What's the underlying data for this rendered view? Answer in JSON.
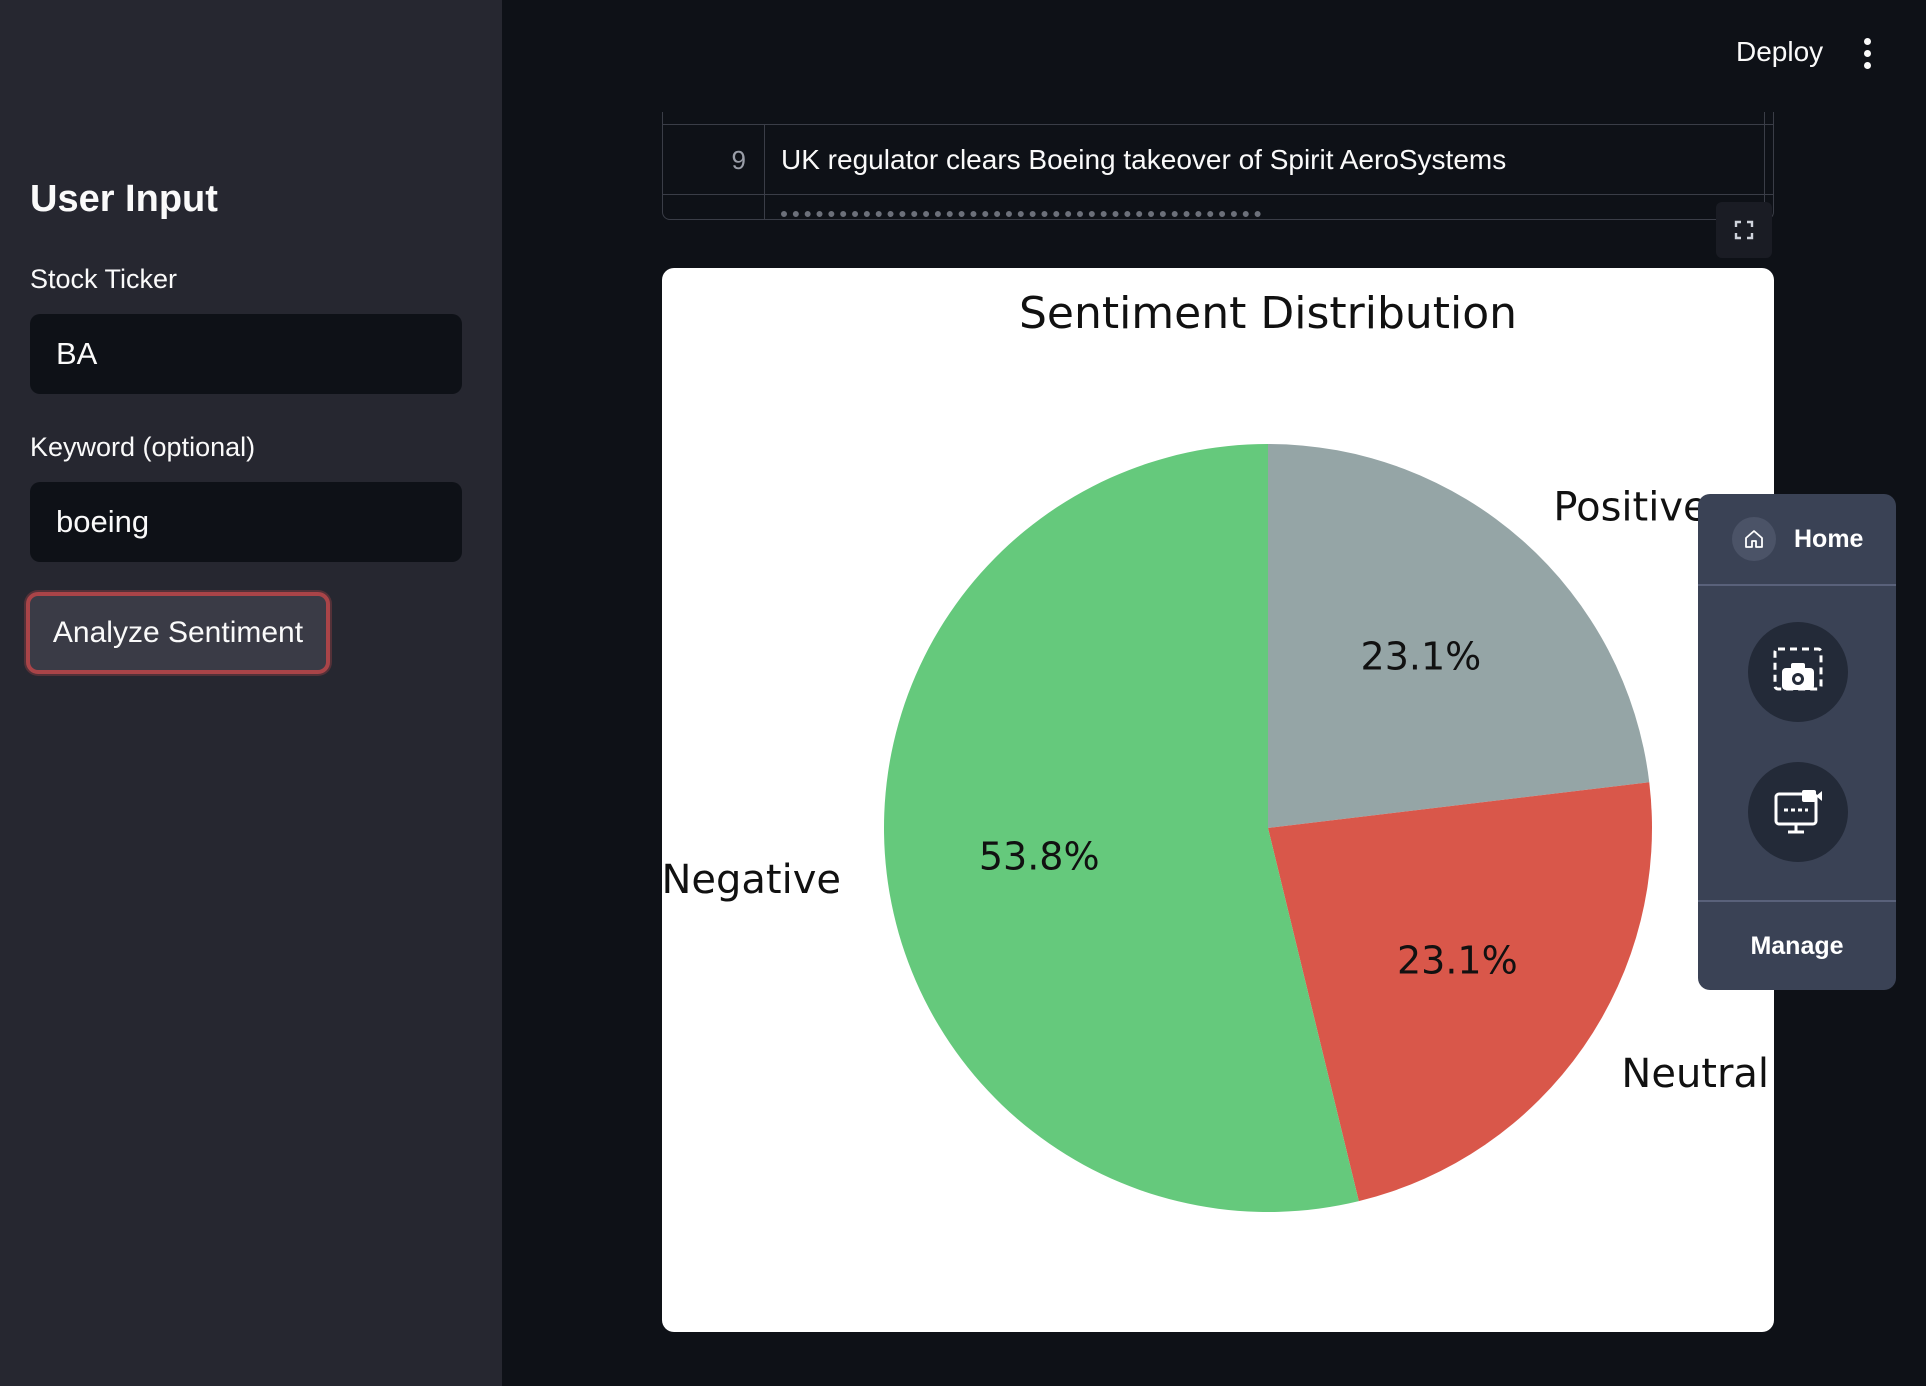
{
  "sidebar": {
    "title": "User Input",
    "ticker_label": "Stock Ticker",
    "ticker_value": "BA",
    "keyword_label": "Keyword (optional)",
    "keyword_value": "boeing",
    "analyze_button": "Analyze Sentiment"
  },
  "header": {
    "deploy_label": "Deploy",
    "menu_icon": "kebab-menu-icon"
  },
  "table": {
    "rows": [
      {
        "index": "9",
        "headline": "UK regulator clears Boeing takeover of Spirit AeroSystems"
      }
    ],
    "expand_icon": "fullscreen-icon"
  },
  "floating_panel": {
    "home_label": "Home",
    "home_icon": "home-icon",
    "screenshot_icon": "camera-capture-icon",
    "record_icon": "screen-record-icon",
    "manage_label": "Manage"
  },
  "chart_data": {
    "type": "pie",
    "title": "Sentiment Distribution",
    "slices": [
      {
        "label": "Positive",
        "value": 23.1,
        "pct_label": "23.1%",
        "color": "#95a5a6"
      },
      {
        "label": "Neutral",
        "value": 23.1,
        "pct_label": "23.1%",
        "color": "#d9574a"
      },
      {
        "label": "Negative",
        "value": 53.8,
        "pct_label": "53.8%",
        "color": "#65c97c"
      }
    ],
    "start_angle": 90,
    "direction": "clockwise"
  },
  "colors": {
    "app_bg": "#0e1117",
    "sidebar_bg": "#262730",
    "button_border": "#a94448",
    "panel_bg": "#3a4255"
  }
}
